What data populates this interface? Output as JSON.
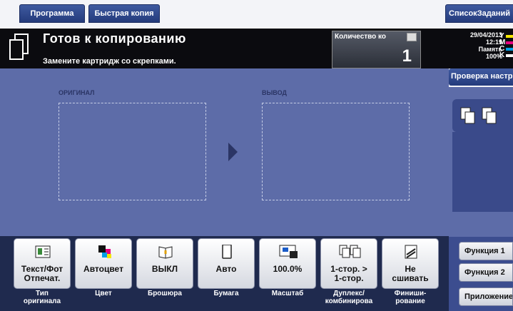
{
  "tabs": {
    "program": "Программа",
    "quick_copy": "Быстрая копия",
    "job_list": "СписокЗаданий"
  },
  "status": {
    "title": "Готов к копированию",
    "subtitle": "Замените картридж со скрепками."
  },
  "counter": {
    "label": "Количество ко",
    "value": "1"
  },
  "meta": {
    "date": "29/04/2013",
    "time": "12:19",
    "memory_label": "Память",
    "memory_value": "100%"
  },
  "toner": [
    {
      "letter": "Y",
      "color": "#f5e600"
    },
    {
      "letter": "M",
      "color": "#e6007e"
    },
    {
      "letter": "C",
      "color": "#00a0e6"
    },
    {
      "letter": "K",
      "color": "#ffffff"
    }
  ],
  "main": {
    "original_label": "ОРИГИНАЛ",
    "output_label": "ВЫВОД"
  },
  "side": {
    "check_settings": "Проверка настро",
    "function1": "Функция 1",
    "function2": "Функция 2",
    "application": "Приложение"
  },
  "functions": [
    {
      "value": "Текст/Фот\nОтпечат.",
      "caption": "Тип\nоригинала",
      "icon": "original-type-icon"
    },
    {
      "value": "Автоцвет",
      "caption": "Цвет",
      "icon": "color-icon"
    },
    {
      "value": "ВЫКЛ",
      "caption": "Брошюра",
      "icon": "booklet-icon"
    },
    {
      "value": "Авто",
      "caption": "Бумага",
      "icon": "paper-icon"
    },
    {
      "value": "100.0%",
      "caption": "Масштаб",
      "icon": "zoom-icon"
    },
    {
      "value": "1-стор. >\n1-стор.",
      "caption": "Дуплекс/\nкомбинирова",
      "icon": "duplex-icon"
    },
    {
      "value": "Не\nсшивать",
      "caption": "Финиши-\nрование",
      "icon": "finishing-icon"
    }
  ],
  "colors": {
    "accent": "#243b7c",
    "work_area": "#5d6ca8",
    "header": "#0b0b0f"
  }
}
